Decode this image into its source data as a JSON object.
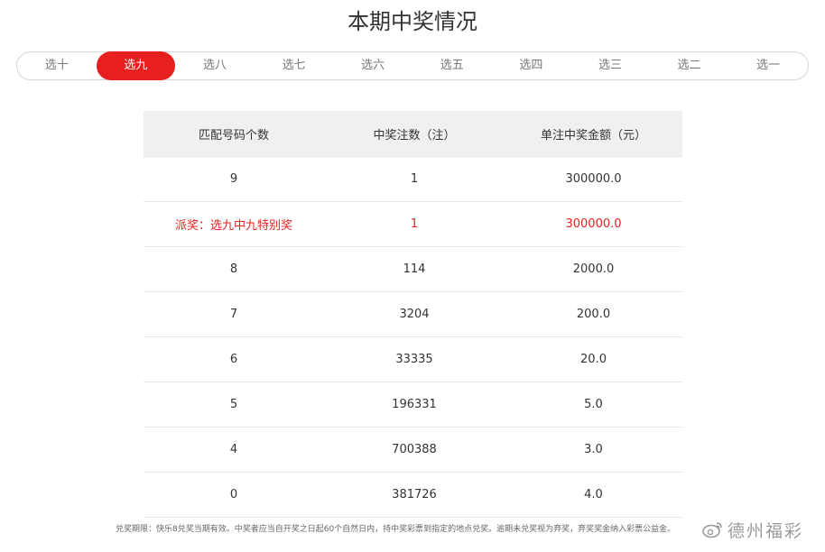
{
  "page": {
    "title": "本期中奖情况"
  },
  "tabs": [
    {
      "label": "选十",
      "active": false
    },
    {
      "label": "选九",
      "active": true
    },
    {
      "label": "选八",
      "active": false
    },
    {
      "label": "选七",
      "active": false
    },
    {
      "label": "选六",
      "active": false
    },
    {
      "label": "选五",
      "active": false
    },
    {
      "label": "选四",
      "active": false
    },
    {
      "label": "选三",
      "active": false
    },
    {
      "label": "选二",
      "active": false
    },
    {
      "label": "选一",
      "active": false
    }
  ],
  "table": {
    "headers": [
      "匹配号码个数",
      "中奖注数（注）",
      "单注中奖金额（元）"
    ],
    "rows": [
      {
        "match": "9",
        "count": "1",
        "amount": "300000.0"
      },
      {
        "match": "派奖：选九中九特别奖",
        "count": "1",
        "amount": "300000.0",
        "highlight": true
      },
      {
        "match": "8",
        "count": "114",
        "amount": "2000.0"
      },
      {
        "match": "7",
        "count": "3204",
        "amount": "200.0"
      },
      {
        "match": "6",
        "count": "33335",
        "amount": "20.0"
      },
      {
        "match": "5",
        "count": "196331",
        "amount": "5.0"
      },
      {
        "match": "4",
        "count": "700388",
        "amount": "3.0"
      },
      {
        "match": "0",
        "count": "381726",
        "amount": "4.0"
      }
    ]
  },
  "footnote": "兑奖期限：快乐8兑奖当期有效。中奖者应当自开奖之日起60个自然日内，持中奖彩票到指定的地点兑奖。逾期未兑奖视为弃奖，弃奖奖金纳入彩票公益金。",
  "watermark": {
    "text": "德州福彩",
    "icon": "weibo-icon"
  },
  "colors": {
    "accent": "#e81f1f",
    "header_bg": "#f0f0f0",
    "text": "#333333",
    "muted": "#777777"
  }
}
